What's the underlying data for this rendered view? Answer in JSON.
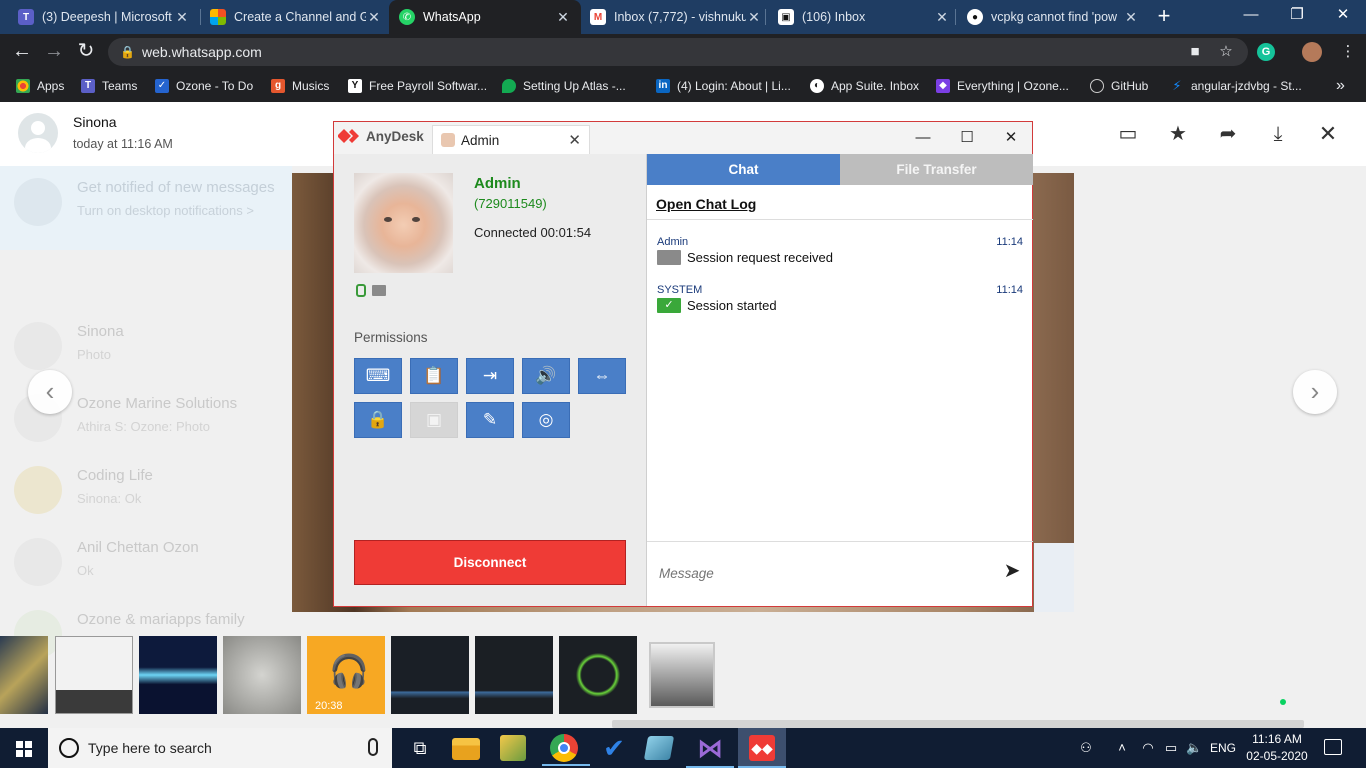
{
  "browser": {
    "tabs": [
      {
        "title": "(3) Deepesh | Microsoft",
        "icon": "teams-icon",
        "color": "#5b5fc7",
        "active": false
      },
      {
        "title": "Create a Channel and G",
        "icon": "microsoft-icon",
        "color": "#f25022",
        "active": false
      },
      {
        "title": "WhatsApp",
        "icon": "whatsapp-icon",
        "color": "#25d366",
        "active": true
      },
      {
        "title": "Inbox (7,772) - vishnuku",
        "icon": "gmail-icon",
        "color": "#ea4335",
        "active": false
      },
      {
        "title": "(106) Inbox",
        "icon": "mailbox-icon",
        "color": "#ffffff",
        "active": false
      },
      {
        "title": "vcpkg cannot find 'pow",
        "icon": "github-icon",
        "color": "#ffffff",
        "active": false
      }
    ],
    "url": "web.whatsapp.com",
    "bookmarks": [
      {
        "label": "Apps",
        "color": "#ea4335"
      },
      {
        "label": "Teams",
        "color": "#5b5fc7"
      },
      {
        "label": "Ozone - To Do",
        "color": "#2564cf"
      },
      {
        "label": "Musics",
        "color": "#e4572e"
      },
      {
        "label": "Free Payroll Softwar...",
        "color": "#ffffff"
      },
      {
        "label": "Setting Up Atlas -...",
        "color": "#13aa52"
      },
      {
        "label": "(4) Login: About | Li...",
        "color": "#0a66c2"
      },
      {
        "label": "App Suite. Inbox",
        "color": "#ffffff"
      },
      {
        "label": "Everything | Ozone...",
        "color": "#7b3fe4"
      },
      {
        "label": "GitHub",
        "color": "#ffffff"
      },
      {
        "label": "angular-jzdvbg - St...",
        "color": "#1389fd"
      }
    ]
  },
  "whatsapp": {
    "contact_name": "Sinona",
    "timestamp": "today at 11:16 AM",
    "thumb_duration": "20:38",
    "background_rows": [
      {
        "name": "Get notified of new messages",
        "sub": "Turn on desktop notifications >"
      },
      {
        "name": "Sinona",
        "sub": "Photo"
      },
      {
        "name": "Ozone Marine Solutions",
        "sub": "Athira S: Ozone: Photo"
      },
      {
        "name": "Coding Life",
        "sub": "Sinona: Ok"
      },
      {
        "name": "Anil Chettan Ozon",
        "sub": "Ok"
      },
      {
        "name": "Ozone & mariapps family",
        "sub": ""
      }
    ]
  },
  "anydesk": {
    "app_name": "AnyDesk",
    "tab_label": "Admin",
    "user_name": "Admin",
    "user_id": "(729011549)",
    "connected": "Connected 00:01:54",
    "permissions_title": "Permissions",
    "disconnect_label": "Disconnect",
    "chat_tab": "Chat",
    "file_transfer_tab": "File Transfer",
    "open_chat_log": "Open Chat Log",
    "messages": [
      {
        "sender": "Admin",
        "time": "11:14",
        "text": "Session request received",
        "icon": "monitor-icon",
        "color": "#8a8a8a"
      },
      {
        "sender": "SYSTEM",
        "time": "11:14",
        "text": "Session started",
        "icon": "monitor-check-icon",
        "color": "#3aa83a"
      }
    ],
    "message_placeholder": "Message",
    "accent": "#ef3b36",
    "tab_blue": "#4a7fc8"
  },
  "taskbar": {
    "search_placeholder": "Type here to search",
    "language": "ENG",
    "time": "11:16 AM",
    "date": "02-05-2020"
  }
}
